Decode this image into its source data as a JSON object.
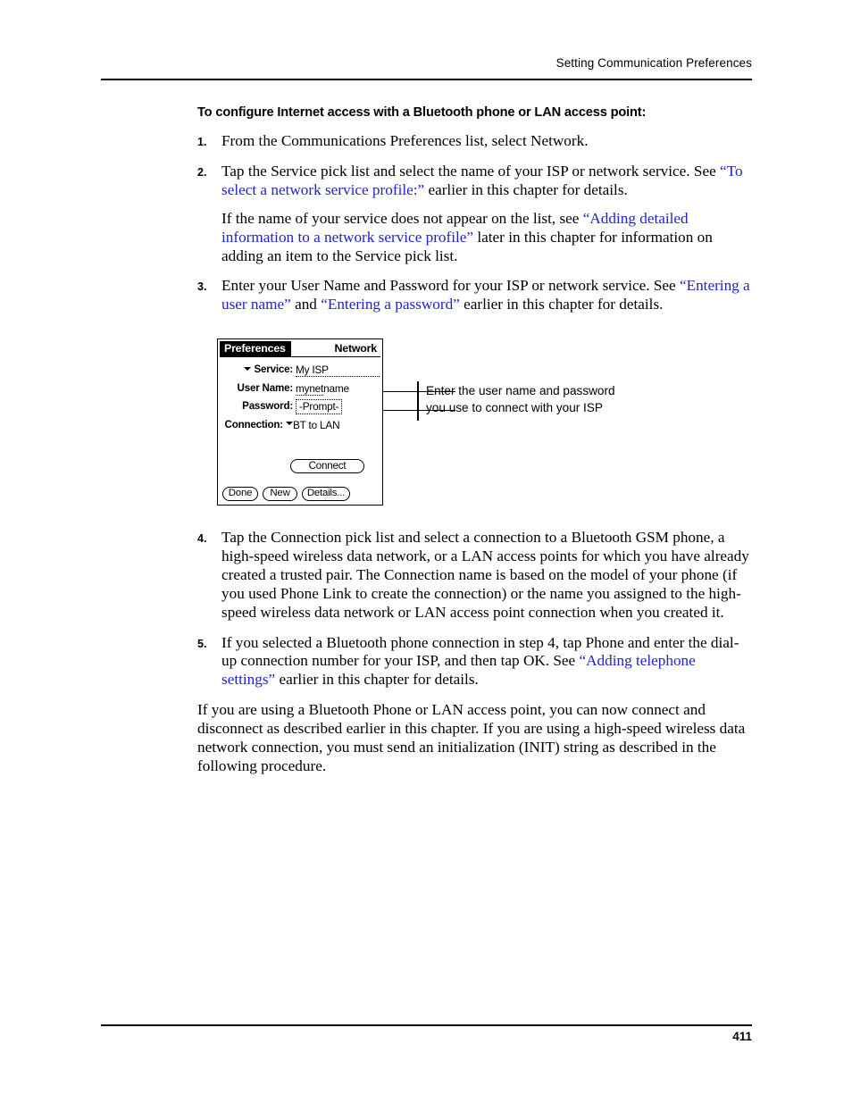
{
  "header": {
    "running_head": "Setting Communication Preferences"
  },
  "heading": "To configure Internet access with a Bluetooth phone or LAN access point:",
  "steps": [
    {
      "num": "1.",
      "paragraphs": [
        [
          {
            "text": "From the Communications Preferences list, select Network.",
            "link": false
          }
        ]
      ]
    },
    {
      "num": "2.",
      "paragraphs": [
        [
          {
            "text": "Tap the Service pick list and select the name of your ISP or network service. See ",
            "link": false
          },
          {
            "text": "“To select a network service profile:”",
            "link": true
          },
          {
            "text": " earlier in this chapter for details.",
            "link": false
          }
        ],
        [
          {
            "text": "If the name of your service does not appear on the list, see ",
            "link": false
          },
          {
            "text": "“Adding detailed information to a network service profile”",
            "link": true
          },
          {
            "text": " later in this chapter for information on adding an item to the Service pick list.",
            "link": false
          }
        ]
      ]
    },
    {
      "num": "3.",
      "paragraphs": [
        [
          {
            "text": "Enter your User Name and Password for your ISP or network service. See ",
            "link": false
          },
          {
            "text": "“Entering a user name”",
            "link": true
          },
          {
            "text": " and ",
            "link": false
          },
          {
            "text": "“Entering a password”",
            "link": true
          },
          {
            "text": " earlier in this chapter for details.",
            "link": false
          }
        ]
      ]
    }
  ],
  "steps_lower": [
    {
      "num": "4.",
      "paragraphs": [
        [
          {
            "text": "Tap the Connection pick list and select a connection to a Bluetooth GSM phone, a high-speed wireless data network, or a LAN access points for which you have already created a trusted pair. The Connection name is based on the model of your phone (if you used Phone Link to create the connection) or the name you assigned to the high-speed wireless data network or LAN access point connection when you created it.",
            "link": false
          }
        ]
      ]
    },
    {
      "num": "5.",
      "paragraphs": [
        [
          {
            "text": "If you selected a Bluetooth phone connection in step 4, tap Phone and enter the dial-up connection number for your ISP, and then tap OK. See ",
            "link": false
          },
          {
            "text": "“Adding telephone settings”",
            "link": true
          },
          {
            "text": " earlier in this chapter for details.",
            "link": false
          }
        ]
      ]
    }
  ],
  "closing_paragraph": "If you are using a Bluetooth Phone or LAN access point, you can now connect and disconnect as described earlier in this chapter. If you are using a high-speed wireless data network connection, you must send an initialization (INIT) string as described in the following procedure.",
  "figure": {
    "pda": {
      "title_tab": "Preferences",
      "title_right": "Network",
      "fields": [
        {
          "label": "Service:",
          "value": "My ISP",
          "has_picker": true,
          "style": "dotted-underline"
        },
        {
          "label": "User Name:",
          "value": "mynetname",
          "has_picker": false,
          "style": "dotted-underline-short"
        },
        {
          "label": "Password:",
          "value": "-Prompt-",
          "has_picker": false,
          "style": "dotted-box"
        },
        {
          "label": "Connection:",
          "value": "BT to LAN",
          "has_picker": true,
          "style": "none"
        }
      ],
      "connect_button": "Connect",
      "done_button": "Done",
      "new_button": "New",
      "details_button": "Details..."
    },
    "callout": {
      "line1": "Enter the user name and password",
      "line2": "you use to connect with your ISP"
    }
  },
  "footer": {
    "page_number": "411"
  },
  "colors": {
    "link": "#2222cc",
    "text": "#000000",
    "background": "#ffffff"
  }
}
